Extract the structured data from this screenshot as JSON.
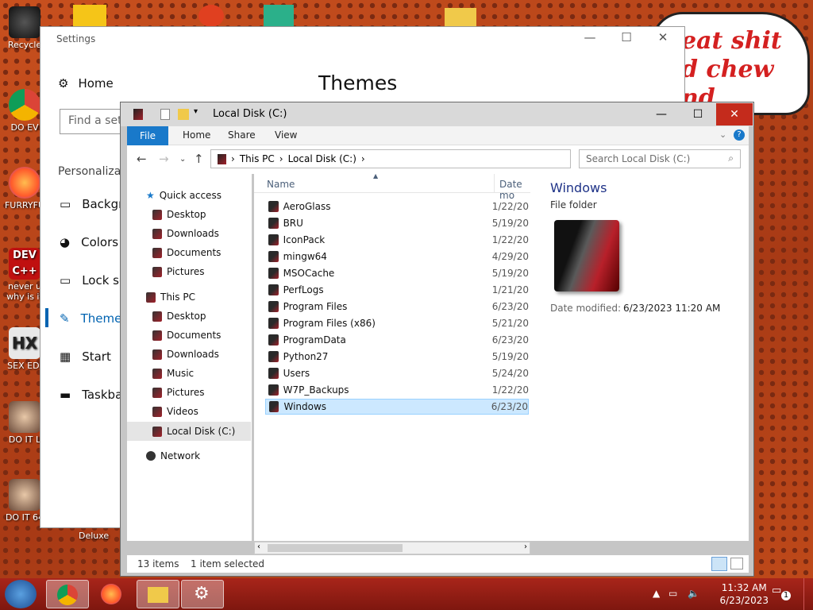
{
  "desktop": {
    "icons": [
      {
        "label": "Recycle"
      },
      {
        "label": "DO EV"
      },
      {
        "label": "FURRYFU"
      },
      {
        "label": "never u why is it"
      },
      {
        "label": "SEX EDI"
      },
      {
        "label": "DO IT L"
      },
      {
        "label": "DO IT 64"
      }
    ],
    "comic_text": "eat shit\nd chew\nnd",
    "deluxe_label": "Deluxe"
  },
  "settings": {
    "title": "Settings",
    "home": "Home",
    "heading": "Themes",
    "search_placeholder": "Find a set",
    "section": "Personaliza",
    "nav": [
      "Backgro",
      "Colors",
      "Lock sc",
      "Theme",
      "Start",
      "Taskba"
    ]
  },
  "explorer": {
    "title": "Local Disk (C:)",
    "ribbon": {
      "file": "File",
      "home": "Home",
      "share": "Share",
      "view": "View"
    },
    "breadcrumb": [
      "This PC",
      "Local Disk (C:)"
    ],
    "search_placeholder": "Search Local Disk (C:)",
    "nav_pane": {
      "quick_access": "Quick access",
      "quick_items": [
        "Desktop",
        "Downloads",
        "Documents",
        "Pictures"
      ],
      "this_pc": "This PC",
      "pc_items": [
        "Desktop",
        "Documents",
        "Downloads",
        "Music",
        "Pictures",
        "Videos",
        "Local Disk (C:)"
      ],
      "network": "Network"
    },
    "columns": {
      "name": "Name",
      "date": "Date mo"
    },
    "files": [
      {
        "name": "AeroGlass",
        "date": "1/22/20"
      },
      {
        "name": "BRU",
        "date": "5/19/20"
      },
      {
        "name": "IconPack",
        "date": "1/22/20"
      },
      {
        "name": "mingw64",
        "date": "4/29/20"
      },
      {
        "name": "MSOCache",
        "date": "5/19/20"
      },
      {
        "name": "PerfLogs",
        "date": "1/21/20"
      },
      {
        "name": "Program Files",
        "date": "6/23/20"
      },
      {
        "name": "Program Files (x86)",
        "date": "5/21/20"
      },
      {
        "name": "ProgramData",
        "date": "6/23/20"
      },
      {
        "name": "Python27",
        "date": "5/19/20"
      },
      {
        "name": "Users",
        "date": "5/24/20"
      },
      {
        "name": "W7P_Backups",
        "date": "1/22/20"
      },
      {
        "name": "Windows",
        "date": "6/23/20"
      }
    ],
    "detail": {
      "name": "Windows",
      "type": "File folder",
      "modified_label": "Date modified:",
      "modified_value": "6/23/2023 11:20 AM"
    },
    "status": {
      "items": "13 items",
      "selected": "1 item selected"
    }
  },
  "taskbar": {
    "time": "11:32 AM",
    "date": "6/23/2023",
    "notification_count": "1"
  }
}
